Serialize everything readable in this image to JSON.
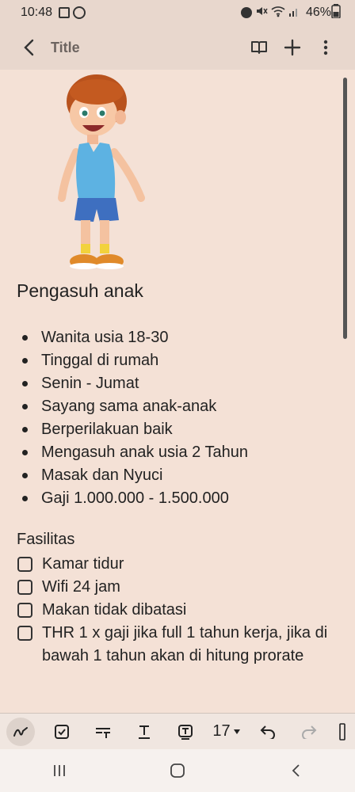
{
  "status": {
    "time": "10:48",
    "battery": "46%"
  },
  "header": {
    "title": "Title"
  },
  "note": {
    "heading": "Pengasuh anak",
    "bullets": [
      "Wanita  usia 18-30",
      "Tinggal di rumah",
      "Senin - Jumat",
      "Sayang sama anak-anak",
      "Berperilakuan baik",
      "Mengasuh anak usia 2 Tahun",
      "Masak dan Nyuci",
      "Gaji 1.000.000 - 1.500.000"
    ],
    "section_label": "Fasilitas",
    "checklist": [
      "Kamar tidur",
      "Wifi 24 jam",
      "Makan tidak dibatasi",
      "THR 1 x gaji jika full 1 tahun kerja, jika di bawah 1 tahun akan di hitung prorate"
    ]
  },
  "toolbar": {
    "font_size": "17"
  },
  "colors": {
    "page_bg": "#f4e1d6",
    "bar_bg": "#e8d7cd"
  }
}
